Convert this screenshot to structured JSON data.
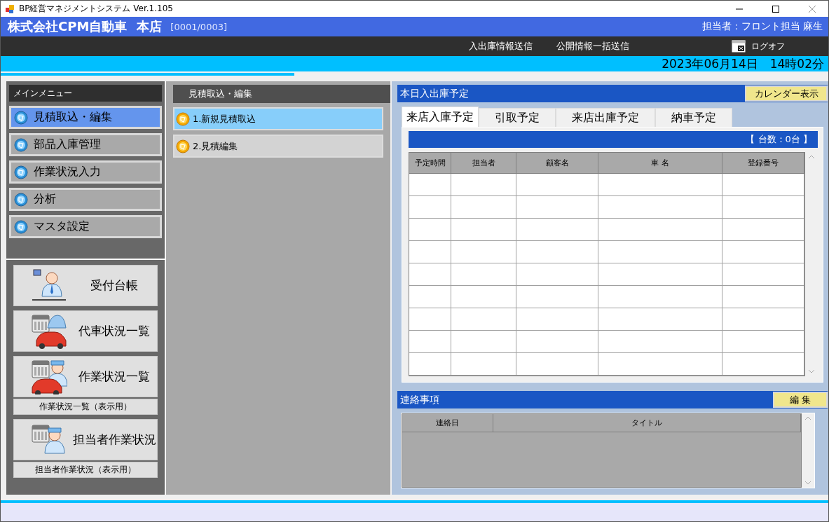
{
  "window": {
    "title": "BP経営マネジメントシステム Ver.1.105"
  },
  "header": {
    "company": "株式会社CPM自動車",
    "branch": "本店",
    "code": "[0001/0003]",
    "user": "担当者：フロント担当 麻生"
  },
  "toolbar": {
    "links": [
      "入出庫情報送信",
      "公開情報一括送信"
    ],
    "logout": "ログオフ"
  },
  "datetime": "2023年06月14日　14時02分",
  "progress": {
    "level": 0.355
  },
  "main_menu": {
    "title": "メインメニュー",
    "items": [
      {
        "label": "見積取込・編集",
        "selected": true
      },
      {
        "label": "部品入庫管理",
        "selected": false
      },
      {
        "label": "作業状況入力",
        "selected": false
      },
      {
        "label": "分析",
        "selected": false
      },
      {
        "label": "マスタ設定",
        "selected": false
      }
    ]
  },
  "shortcuts": [
    {
      "kind": "reception",
      "label": "受付台帳"
    },
    {
      "kind": "loaner",
      "label": "代車状況一覧"
    },
    {
      "kind": "work",
      "label": "作業状況一覧",
      "sub_label": "作業状況一覧（表示用）"
    },
    {
      "kind": "staff",
      "label": "担当者作業状況",
      "sub_label": "担当者作業状況（表示用）"
    }
  ],
  "submenu": {
    "title": "見積取込・編集",
    "items": [
      {
        "label": "1.新規見積取込",
        "selected": true
      },
      {
        "label": "2.見積編集",
        "selected": false
      }
    ]
  },
  "schedule": {
    "title": "本日入出庫予定",
    "calendar_button": "カレンダー表示",
    "tabs": [
      {
        "label": "来店入庫予定",
        "selected": true
      },
      {
        "label": "引取予定",
        "selected": false
      },
      {
        "label": "来店出庫予定",
        "selected": false
      },
      {
        "label": "納車予定",
        "selected": false
      }
    ],
    "count": "【 台数：0台 】",
    "columns": [
      "予定時間",
      "担当者",
      "顧客名",
      "車 名",
      "登録番号"
    ]
  },
  "notices": {
    "title": "連絡事項",
    "edit_button": "編 集",
    "columns": [
      "連絡日",
      "タイトル"
    ]
  }
}
